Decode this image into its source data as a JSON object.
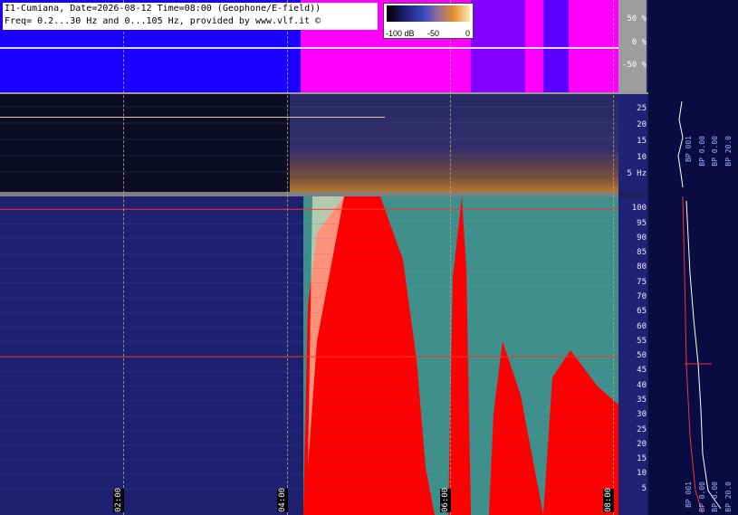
{
  "header": {
    "line1": "I1-Cumiana, Date=2026-08-12 Time=08:00 (Geophone/E-field))",
    "line2": "Freq= 0.2...30 Hz and 0...105 Hz, provided by www.vlf.it ©"
  },
  "colorbar": {
    "labels": [
      "-100 dB",
      "-50",
      "0"
    ]
  },
  "colors": {
    "top_low": "#1a00ff",
    "top_high": "#ff00ff",
    "signal": "#ff0000",
    "spectrum_bg": "#1d2170"
  },
  "chart_data": [
    {
      "type": "line",
      "title": "",
      "ylabel": "%",
      "ytick_labels": [
        "50 %",
        "0 %",
        "-50 %"
      ],
      "ylim": [
        -100,
        100
      ],
      "grid": false
    },
    {
      "type": "heatmap",
      "ylabel": "Hz",
      "ytick_labels": [
        "25",
        "20",
        "15",
        "10",
        "5 Hz"
      ],
      "ylim": [
        0,
        30
      ],
      "grid": true
    },
    {
      "type": "heatmap",
      "ylabel": "Hz",
      "ytick_labels": [
        "100",
        "95",
        "90",
        "85",
        "80",
        "75",
        "70",
        "65",
        "60",
        "55",
        "50",
        "45",
        "40",
        "35",
        "30",
        "25",
        "20",
        "15",
        "10",
        "5"
      ],
      "ylim": [
        0,
        105
      ],
      "x_tick_labels": [
        "02:00",
        "04:00",
        "06:00",
        "08:00"
      ],
      "lines": [
        {
          "name": "",
          "y": 50
        },
        {
          "name": "",
          "y": 100
        }
      ],
      "grid": true
    }
  ],
  "profile": {
    "bp_labels": [
      "BP 001",
      "BP 0.00",
      "BP 0.00",
      "BP 20.0",
      "BP 001",
      "BP 0.00",
      "BP 0.00",
      "BP 20.0"
    ]
  }
}
